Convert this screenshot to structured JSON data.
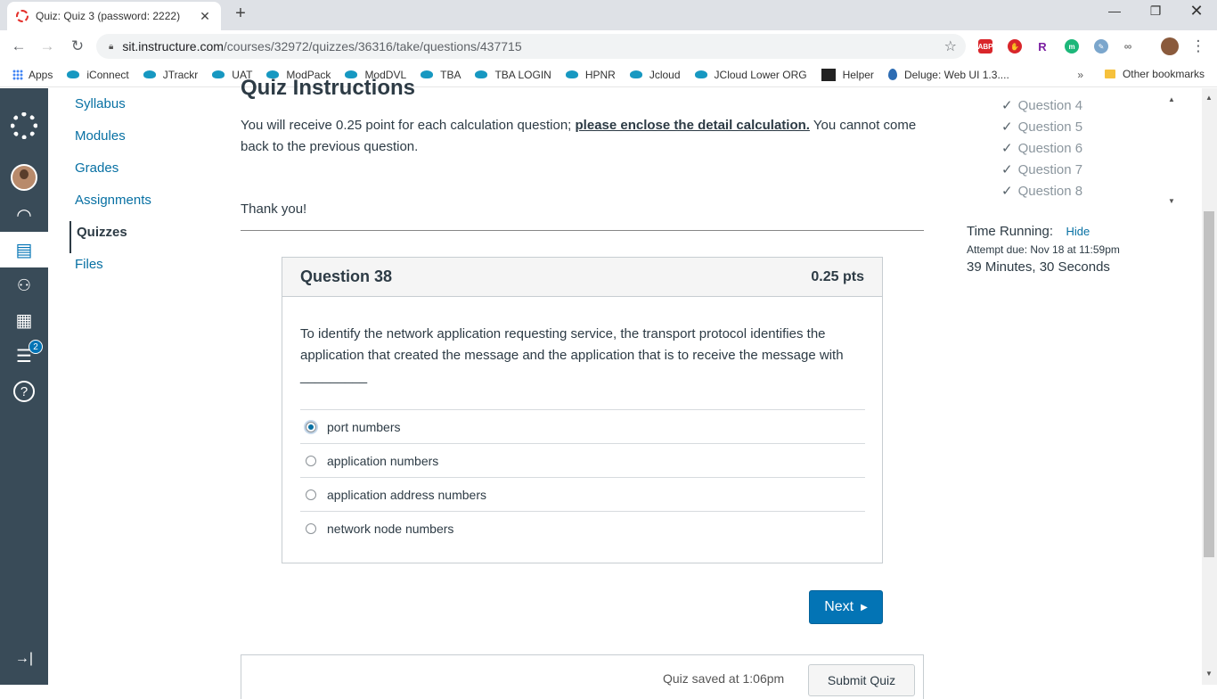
{
  "browser": {
    "tab_title": "Quiz: Quiz 3 (password: 2222)",
    "url_host": "sit.instructure.com",
    "url_path": "/courses/32972/quizzes/36316/take/questions/437715",
    "bookmarks": [
      "Apps",
      "iConnect",
      "JTrackr",
      "UAT",
      "ModPack",
      "ModDVL",
      "TBA",
      "TBA LOGIN",
      "HPNR",
      "Jcloud",
      "JCloud Lower ORG",
      "Helper",
      "Deluge: Web UI 1.3...."
    ],
    "bookmarks_more": "»",
    "other_bookmarks": "Other bookmarks",
    "extensions": {
      "abp": "ABP",
      "r": "R",
      "m": "m"
    }
  },
  "global_nav": {
    "inbox_badge": "2",
    "collapse_icon": "→|",
    "help_icon": "?"
  },
  "course_nav": {
    "items": [
      "Syllabus",
      "Modules",
      "Grades",
      "Assignments",
      "Quizzes",
      "Files"
    ],
    "active": "Quizzes"
  },
  "instructions": {
    "heading_cut": "Quiz Instructions",
    "text_before": "You will receive 0.25 point for each calculation question; ",
    "text_emphasis": "please enclose the detail calculation.",
    "text_after": " You cannot come back to the previous question.",
    "thanks": "Thank you!"
  },
  "question": {
    "title": "Question 38",
    "points": "0.25 pts",
    "text": "To identify the network application requesting service, the transport protocol identifies the application that created the message and the application that is to receive the message with _________",
    "answers": [
      "port numbers",
      "application numbers",
      "application address numbers",
      "network node numbers"
    ],
    "selected_index": 0
  },
  "next_button": "Next",
  "footer": {
    "saved_text": "Quiz saved at 1:06pm",
    "submit_label": "Submit Quiz"
  },
  "sidebar": {
    "questions": [
      "Question 4",
      "Question 5",
      "Question 6",
      "Question 7",
      "Question 8"
    ],
    "timer_label": "Time Running:",
    "hide_label": "Hide",
    "attempt_due": "Attempt due: Nov 18 at 11:59pm",
    "time_left": "39 Minutes, 30 Seconds"
  },
  "colors": {
    "canvas_nav": "#394b58",
    "link": "#0770a3",
    "primary_button": "#0374b5"
  }
}
